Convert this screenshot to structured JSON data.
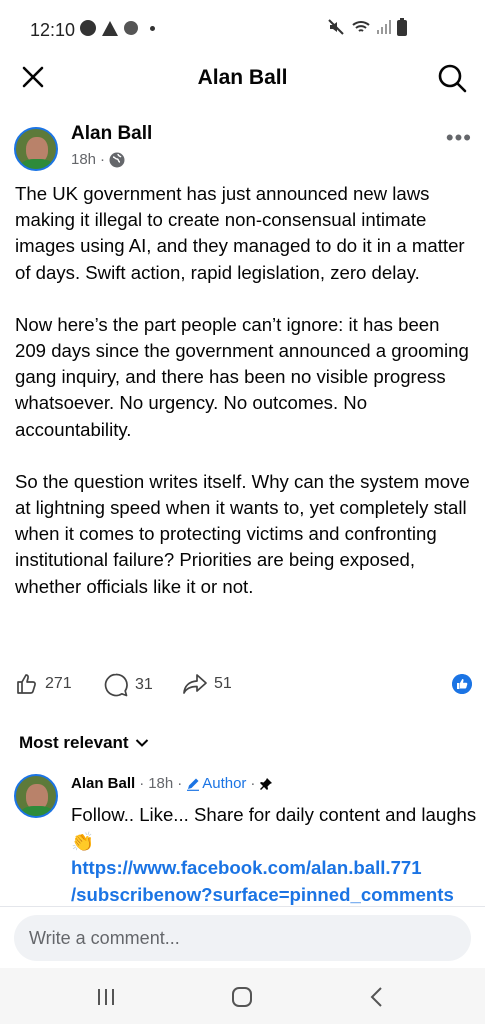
{
  "status_bar": {
    "time": "12:10"
  },
  "app_bar": {
    "title": "Alan Ball"
  },
  "post": {
    "author": "Alan Ball",
    "time": "18h",
    "separator": "·",
    "paragraphs": [
      "The UK government has just announced new laws making it illegal to create non-consensual intimate images using AI, and they managed to do it in a matter of days. Swift action, rapid legislation, zero delay.",
      "Now here’s the part people can’t ignore: it has been 209 days since the government announced a grooming gang inquiry, and there has been no visible progress whatsoever. No urgency. No outcomes. No accountability.",
      "So the question writes itself. Why can the system move at lightning speed when it wants to, yet completely stall when it comes to protecting victims and confronting institutional failure? Priorities are being exposed, whether officials like it or not."
    ],
    "likes": "271",
    "comments": "31",
    "shares": "51"
  },
  "comments_section": {
    "sort_label": "Most relevant",
    "pinned_comment": {
      "author": "Alan Ball",
      "time": "18h",
      "badge": "Author",
      "separator": "·",
      "text": "Follow.. Like... Share for daily content and laughs",
      "emoji": "👏",
      "link_line1": "https://www.facebook.com/alan.ball.771",
      "link_line2": "/subscribenow?surface=pinned_comments"
    }
  },
  "composer": {
    "placeholder": "Write a comment..."
  },
  "colors": {
    "accent": "#1b74e4",
    "secondary_text": "#65676b"
  }
}
